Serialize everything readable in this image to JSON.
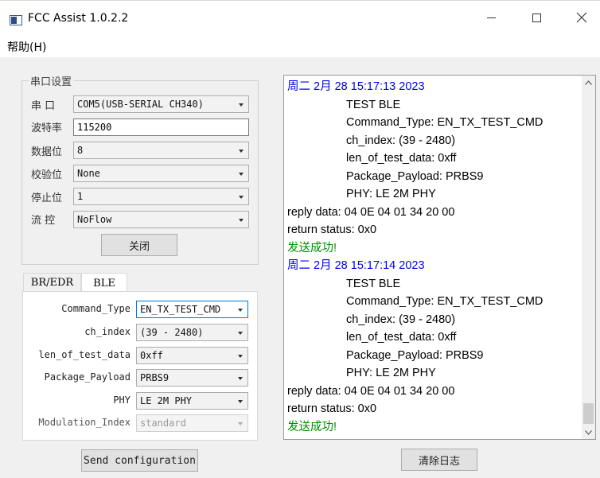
{
  "window": {
    "title": "FCC Assist 1.0.2.2",
    "menu": "帮助(H)"
  },
  "serial": {
    "group_title": "串口设置",
    "rows": [
      {
        "label": "串  口",
        "value": "COM5(USB-SERIAL CH340)"
      },
      {
        "label": "波特率",
        "value": "115200"
      },
      {
        "label": "数据位",
        "value": "8"
      },
      {
        "label": "校验位",
        "value": "None"
      },
      {
        "label": "停止位",
        "value": "1"
      },
      {
        "label": "流  控",
        "value": "NoFlow"
      }
    ],
    "close_button": "关闭"
  },
  "tabs": [
    "BR/EDR",
    "BLE"
  ],
  "ble": {
    "rows": [
      {
        "label": "Command_Type",
        "value": "EN_TX_TEST_CMD"
      },
      {
        "label": "ch_index",
        "value": "(39 - 2480)"
      },
      {
        "label": "len_of_test_data",
        "value": "0xff"
      },
      {
        "label": "Package_Payload",
        "value": "PRBS9"
      },
      {
        "label": "PHY",
        "value": "LE 2M PHY"
      },
      {
        "label": "Modulation_Index",
        "value": "standard"
      }
    ]
  },
  "send_button": "Send configuration",
  "clear_button": "清除日志",
  "log": [
    {
      "text": "周二 2月 28 15:17:13 2023",
      "kind": "ts"
    },
    {
      "text": "TEST BLE",
      "kind": "indent"
    },
    {
      "text": "Command_Type: EN_TX_TEST_CMD",
      "kind": "indent"
    },
    {
      "text": "ch_index: (39 - 2480)",
      "kind": "indent"
    },
    {
      "text": "len_of_test_data: 0xff",
      "kind": "indent"
    },
    {
      "text": "Package_Payload: PRBS9",
      "kind": "indent"
    },
    {
      "text": "PHY: LE 2M PHY",
      "kind": "indent"
    },
    {
      "text": "reply data: 04 0E 04 01 34 20 00",
      "kind": "plain"
    },
    {
      "text": "return status: 0x0",
      "kind": "plain"
    },
    {
      "text": "发送成功!",
      "kind": "ok"
    },
    {
      "text": "周二 2月 28 15:17:14 2023",
      "kind": "ts"
    },
    {
      "text": "TEST BLE",
      "kind": "indent"
    },
    {
      "text": "Command_Type: EN_TX_TEST_CMD",
      "kind": "indent"
    },
    {
      "text": "ch_index: (39 - 2480)",
      "kind": "indent"
    },
    {
      "text": "len_of_test_data: 0xff",
      "kind": "indent"
    },
    {
      "text": "Package_Payload: PRBS9",
      "kind": "indent"
    },
    {
      "text": "PHY: LE 2M PHY",
      "kind": "indent"
    },
    {
      "text": "reply data: 04 0E 04 01 34 20 00",
      "kind": "plain"
    },
    {
      "text": "return status: 0x0",
      "kind": "plain"
    },
    {
      "text": "发送成功!",
      "kind": "ok"
    }
  ],
  "colors": {
    "timestamp": "#0000ee",
    "success": "#009000",
    "focus": "#0078d7"
  }
}
